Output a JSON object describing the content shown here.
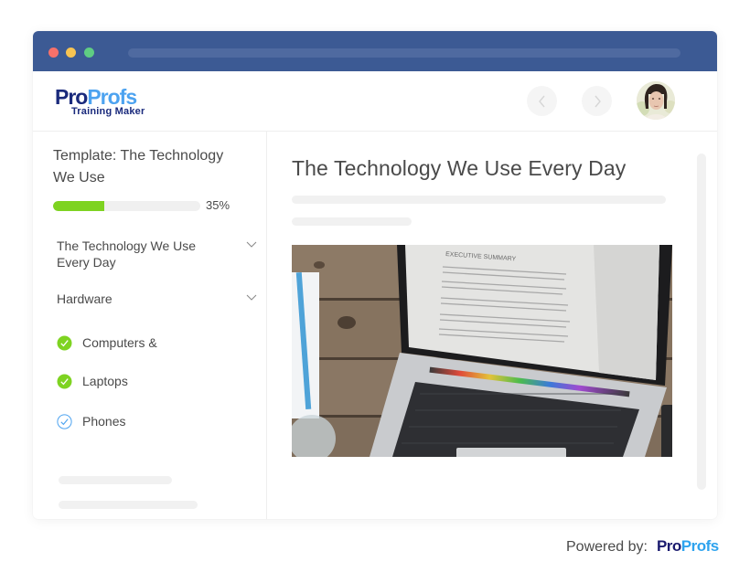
{
  "window": {
    "controls": [
      "close",
      "minimize",
      "maximize"
    ]
  },
  "header": {
    "logo": {
      "brand_part1": "Pro",
      "brand_part2": "Profs",
      "product": "Training Maker"
    },
    "prev_icon": "chevron-left-icon",
    "next_icon": "chevron-right-icon",
    "avatar": "user-avatar"
  },
  "sidebar": {
    "course_title": "Template: The Technology We Use",
    "progress": {
      "percent": 35,
      "label": "35%"
    },
    "sections": [
      {
        "label": "The Technology We Use Every Day",
        "icon": "chevron-down-icon"
      },
      {
        "label": "Hardware",
        "icon": "chevron-down-icon"
      }
    ],
    "lessons": [
      {
        "label": "Computers &",
        "status": "completed",
        "icon": "check-circle-filled-icon"
      },
      {
        "label": "Laptops",
        "status": "completed",
        "icon": "check-circle-filled-icon"
      },
      {
        "label": "Phones",
        "status": "current",
        "icon": "check-circle-outline-icon"
      }
    ]
  },
  "content": {
    "title": "The Technology We Use Every Day",
    "image": "laptop-on-wooden-desk-photo",
    "image_text": "EXECUTIVE SUMMARY"
  },
  "footer": {
    "powered_by": "Powered by:",
    "brand_part1": "Pro",
    "brand_part2": "Profs"
  },
  "colors": {
    "titlebar": "#3c5a94",
    "progress": "#7ed321",
    "brand_dark": "#1a2a7c",
    "brand_light": "#4da3f0",
    "check_green": "#7ed321",
    "check_blue": "#4da3f0"
  }
}
